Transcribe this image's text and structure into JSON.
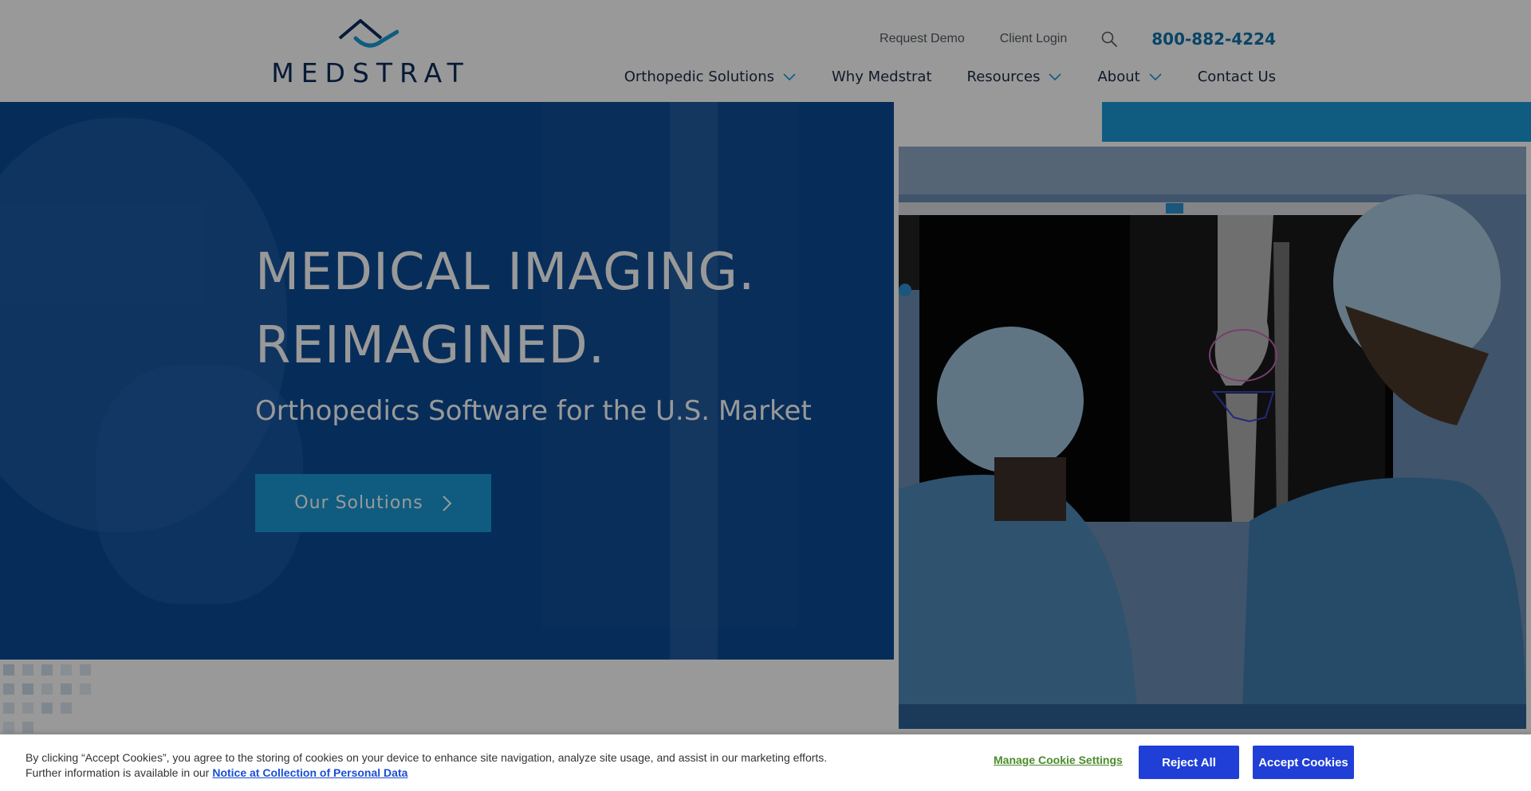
{
  "brand": {
    "name": "MEDSTRAT"
  },
  "utility_nav": {
    "request_demo": "Request Demo",
    "client_login": "Client Login",
    "search_icon": "search-icon",
    "phone": "800-882-4224"
  },
  "main_nav": {
    "items": [
      {
        "label": "Orthopedic Solutions",
        "has_dropdown": true
      },
      {
        "label": "Why Medstrat",
        "has_dropdown": false
      },
      {
        "label": "Resources",
        "has_dropdown": true
      },
      {
        "label": "About",
        "has_dropdown": true
      },
      {
        "label": "Contact Us",
        "has_dropdown": false
      }
    ]
  },
  "hero": {
    "title_line1": "MEDICAL IMAGING.",
    "title_line2": "REIMAGINED.",
    "subtitle": "Orthopedics Software for the U.S. Market",
    "cta_label": "Our Solutions"
  },
  "cookie_banner": {
    "text": "By clicking “Accept Cookies”, you agree to the storing of cookies on your device to enhance site navigation, analyze site usage, and assist in our marketing efforts. Further information is available in our",
    "notice_link": "Notice at Collection of Personal Data",
    "manage_label": "Manage Cookie Settings",
    "reject_label": "Reject All",
    "accept_label": "Accept Cookies"
  },
  "colors": {
    "brand_navy": "#0d2c5c",
    "accent_blue": "#1a9ad6",
    "hero_blue": "#0a4c97",
    "phone_blue": "#1274a8",
    "cookie_button": "#1f3fd6",
    "cookie_manage": "#4a8c2a"
  }
}
